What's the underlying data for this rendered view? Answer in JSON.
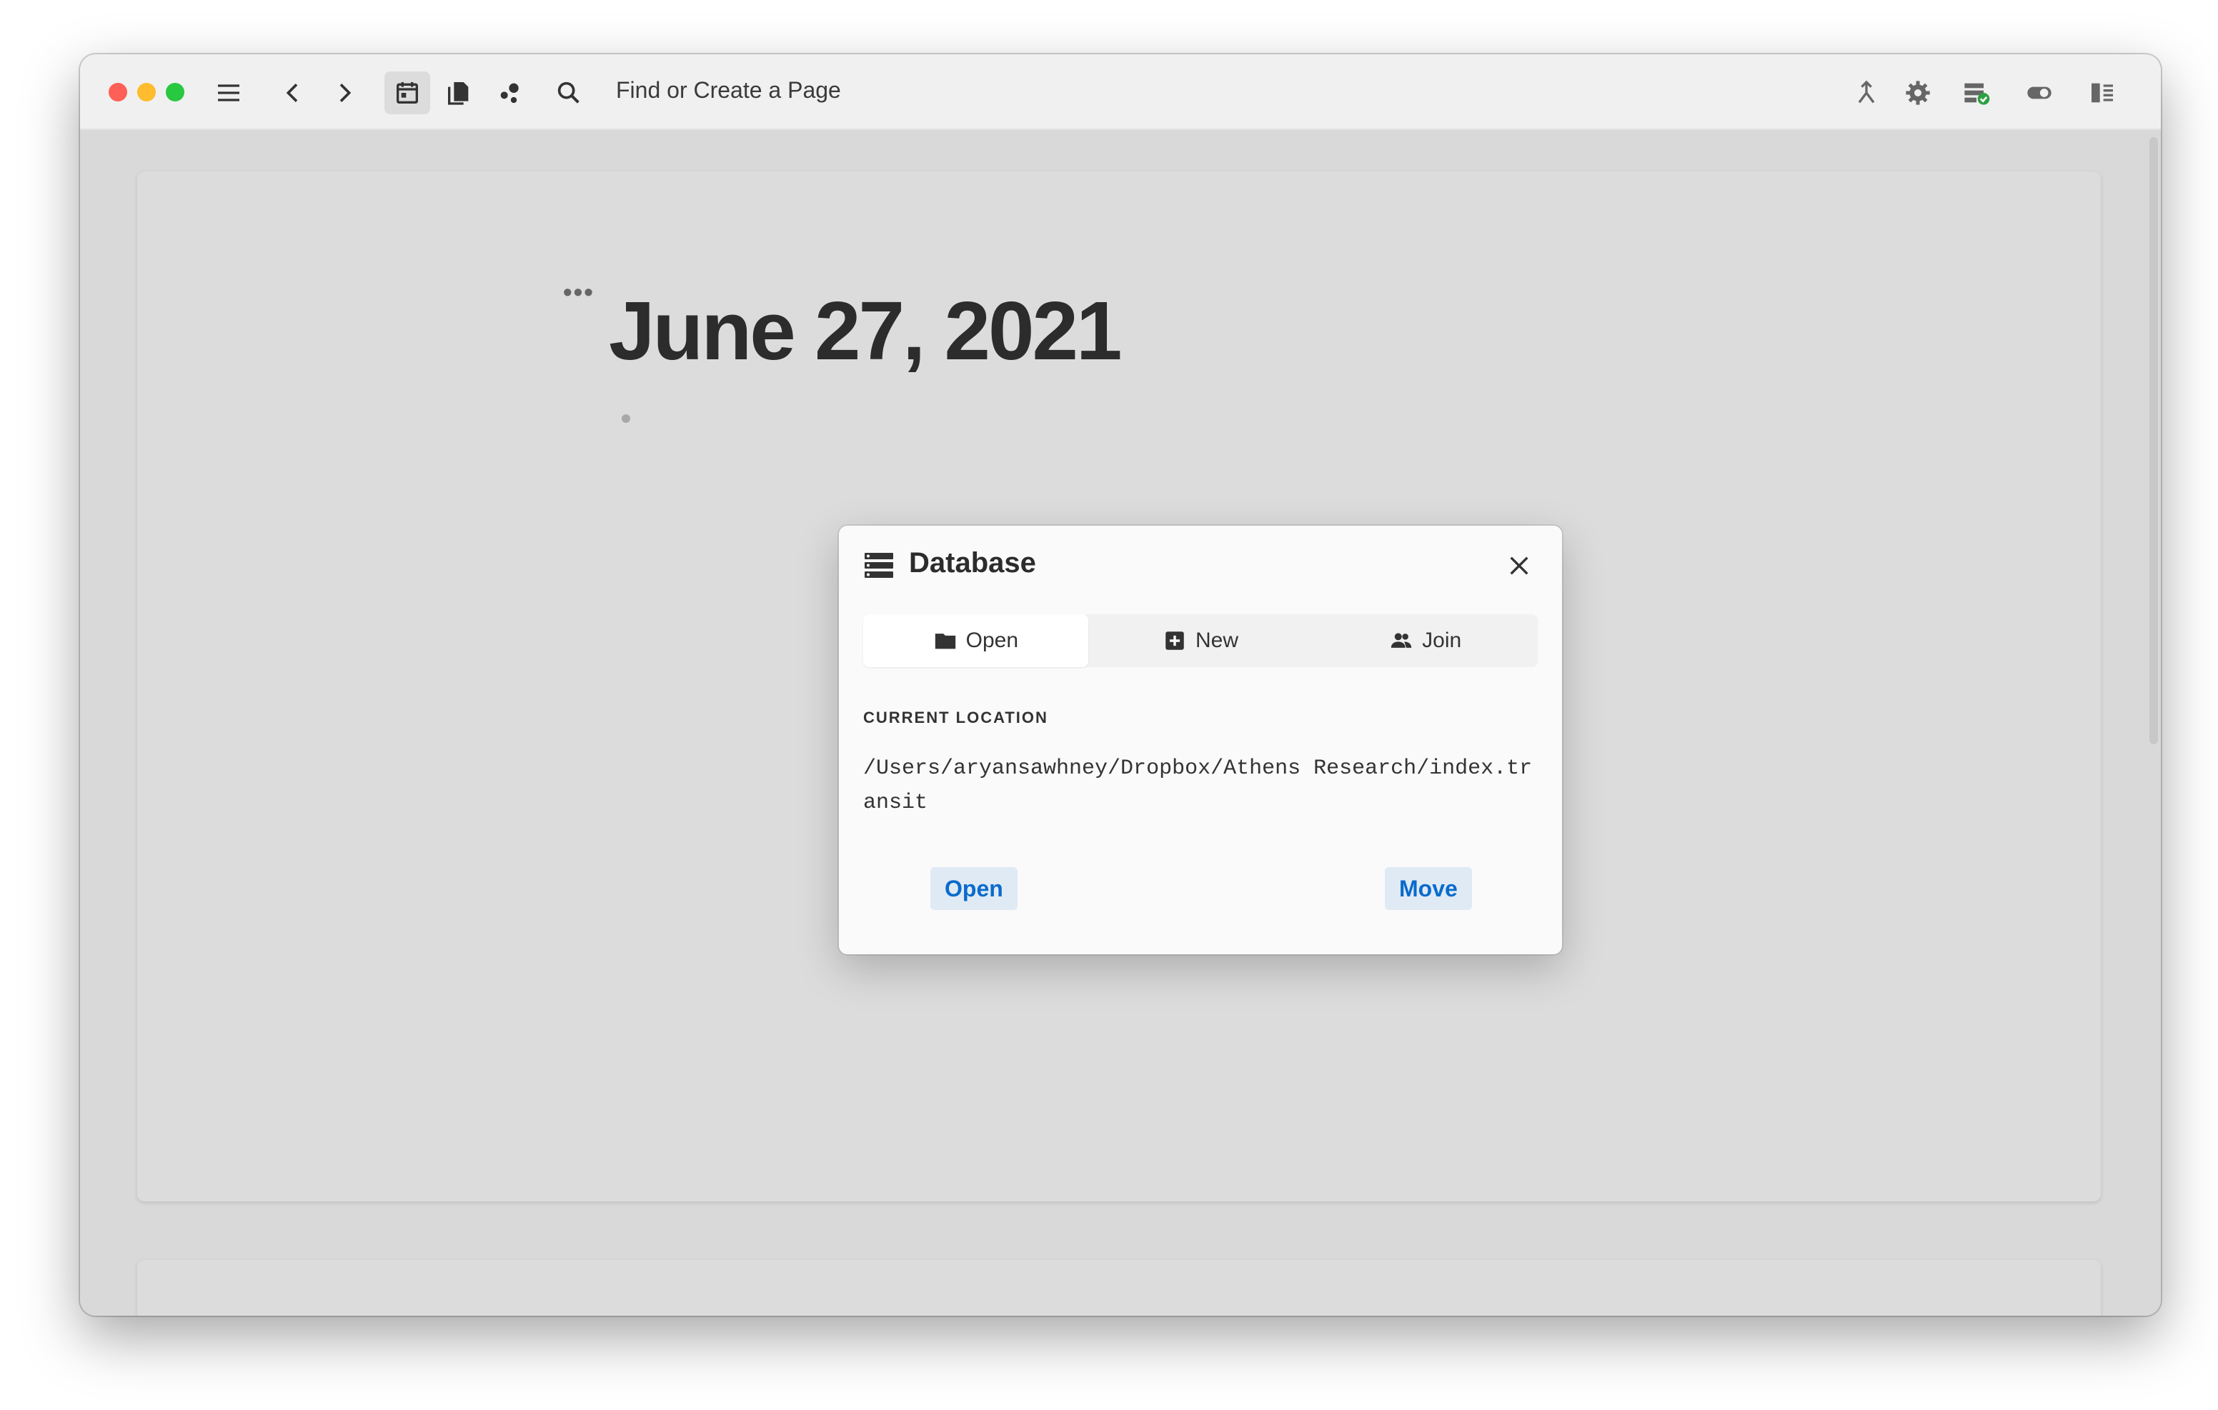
{
  "toolbar": {
    "search_placeholder": "Find or Create a Page",
    "icons": [
      "menu-icon",
      "back-icon",
      "forward-icon",
      "calendar-icon",
      "pages-icon",
      "graph-icon",
      "search-icon",
      "merge-icon",
      "settings-icon",
      "database-sync-icon",
      "theme-toggle-icon",
      "right-sidebar-icon"
    ]
  },
  "page": {
    "title": "June 27, 2021",
    "ellipsis": "•••"
  },
  "dialog": {
    "title": "Database",
    "tabs": [
      {
        "label": "Open",
        "icon": "folder-icon",
        "active": true
      },
      {
        "label": "New",
        "icon": "add-box-icon",
        "active": false
      },
      {
        "label": "Join",
        "icon": "people-icon",
        "active": false
      }
    ],
    "location_label": "CURRENT LOCATION",
    "location_path": "/Users/aryansawhney/Dropbox/Athens Research/index.transit",
    "open_label": "Open",
    "move_label": "Move"
  },
  "colors": {
    "accent": "#0b6bcb",
    "accent_bg": "#dfeaf5",
    "sync_ok": "#2ea043"
  }
}
